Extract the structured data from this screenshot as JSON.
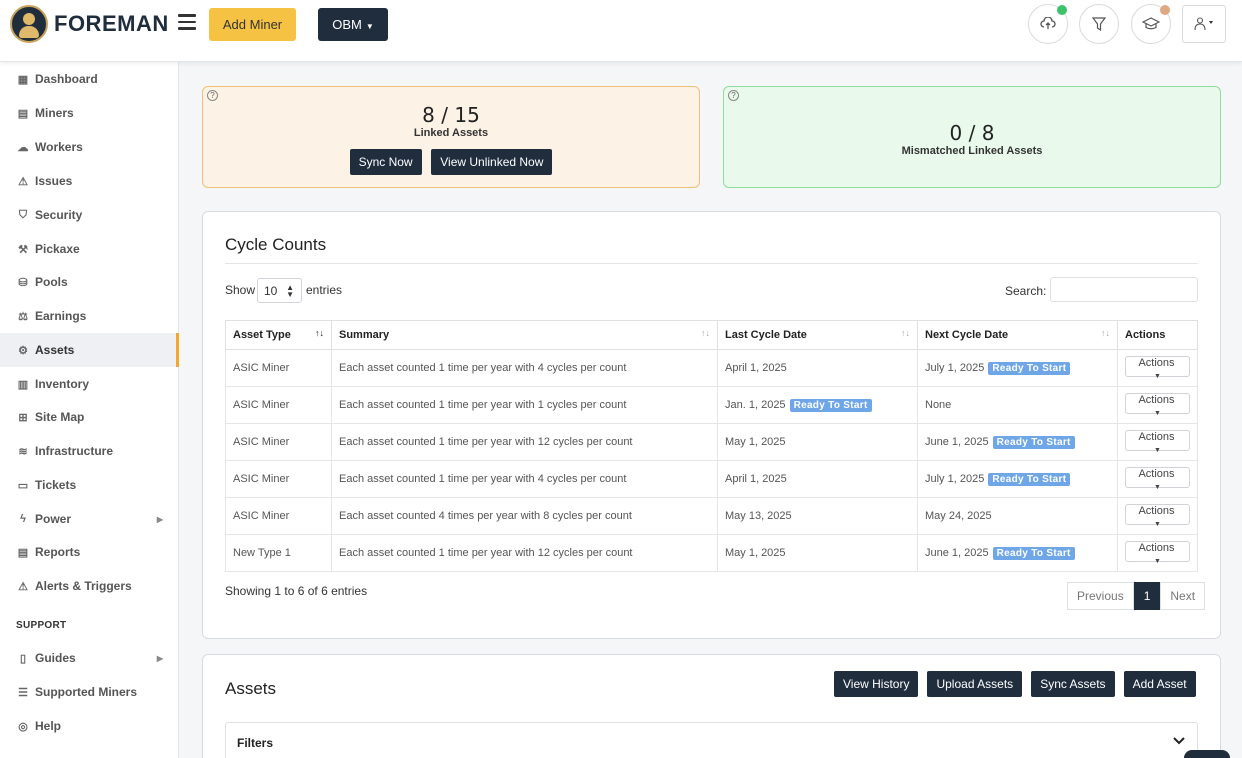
{
  "brand": {
    "name": "FOREMAN"
  },
  "header": {
    "add_miner": "Add Miner",
    "org_select": "OBM",
    "icons": [
      "upload-cloud-icon",
      "filter-icon",
      "graduation-cap-icon",
      "user-menu-icon"
    ],
    "status_colors": {
      "upload": "#3cc36a",
      "learn": "#e0a882"
    }
  },
  "sidebar": {
    "items": [
      {
        "label": "Dashboard",
        "icon": "dashboard-icon"
      },
      {
        "label": "Miners",
        "icon": "miners-icon"
      },
      {
        "label": "Workers",
        "icon": "workers-icon"
      },
      {
        "label": "Issues",
        "icon": "warning-icon"
      },
      {
        "label": "Security",
        "icon": "shield-icon"
      },
      {
        "label": "Pickaxe",
        "icon": "pickaxe-icon"
      },
      {
        "label": "Pools",
        "icon": "pools-icon"
      },
      {
        "label": "Earnings",
        "icon": "earnings-icon"
      },
      {
        "label": "Assets",
        "icon": "assets-icon",
        "active": true
      },
      {
        "label": "Inventory",
        "icon": "inventory-icon"
      },
      {
        "label": "Site Map",
        "icon": "sitemap-icon"
      },
      {
        "label": "Infrastructure",
        "icon": "layers-icon"
      },
      {
        "label": "Tickets",
        "icon": "ticket-icon"
      },
      {
        "label": "Power",
        "icon": "bolt-icon",
        "has_children": true
      },
      {
        "label": "Reports",
        "icon": "report-icon"
      },
      {
        "label": "Alerts & Triggers",
        "icon": "alert-icon"
      }
    ],
    "support_heading": "SUPPORT",
    "support_items": [
      {
        "label": "Guides",
        "icon": "guide-icon",
        "has_children": true
      },
      {
        "label": "Supported Miners",
        "icon": "list-icon"
      },
      {
        "label": "Help",
        "icon": "help-icon"
      }
    ]
  },
  "linked": {
    "value": "8 / 15",
    "label": "Linked Assets",
    "sync_now": "Sync Now",
    "view_unlinked": "View Unlinked Now"
  },
  "mismatched": {
    "value": "0 / 8",
    "label": "Mismatched Linked Assets"
  },
  "cycle_counts": {
    "title": "Cycle Counts",
    "show_label": "Show",
    "entries_value": "10",
    "entries_label": "entries",
    "search_label": "Search:",
    "columns": [
      "Asset Type",
      "Summary",
      "Last Cycle Date",
      "Next Cycle Date",
      "Actions"
    ],
    "rows": [
      {
        "asset_type": "ASIC Miner",
        "summary": "Each asset counted 1 time per year with 4 cycles per count",
        "last": "April 1, 2025",
        "last_badge": "",
        "next": "July 1, 2025",
        "next_badge": "Ready To Start",
        "action": "Actions"
      },
      {
        "asset_type": "ASIC Miner",
        "summary": "Each asset counted 1 time per year with 1 cycles per count",
        "last": "Jan. 1, 2025",
        "last_badge": "Ready To Start",
        "next": "None",
        "next_badge": "",
        "action": "Actions"
      },
      {
        "asset_type": "ASIC Miner",
        "summary": "Each asset counted 1 time per year with 12 cycles per count",
        "last": "May 1, 2025",
        "last_badge": "",
        "next": "June 1, 2025",
        "next_badge": "Ready To Start",
        "action": "Actions"
      },
      {
        "asset_type": "ASIC Miner",
        "summary": "Each asset counted 1 time per year with 4 cycles per count",
        "last": "April 1, 2025",
        "last_badge": "",
        "next": "July 1, 2025",
        "next_badge": "Ready To Start",
        "action": "Actions"
      },
      {
        "asset_type": "ASIC Miner",
        "summary": "Each asset counted 4 times per year with 8 cycles per count",
        "last": "May 13, 2025",
        "last_badge": "",
        "next": "May 24, 2025",
        "next_badge": "",
        "action": "Actions"
      },
      {
        "asset_type": "New Type 1",
        "summary": "Each asset counted 1 time per year with 12 cycles per count",
        "last": "May 1, 2025",
        "last_badge": "",
        "next": "June 1, 2025",
        "next_badge": "Ready To Start",
        "action": "Actions"
      }
    ],
    "info": "Showing 1 to 6 of 6 entries",
    "pager": {
      "previous": "Previous",
      "current": "1",
      "next": "Next"
    }
  },
  "assets": {
    "title": "Assets",
    "view_history": "View History",
    "upload_assets": "Upload Assets",
    "sync_assets": "Sync Assets",
    "add_asset": "Add Asset",
    "filters_label": "Filters"
  }
}
